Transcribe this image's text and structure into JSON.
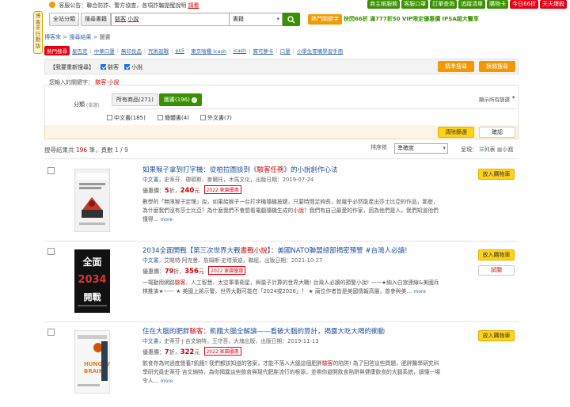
{
  "sidetab": "博客來\n行動版\n\n電腦版\n全站分類",
  "notice": {
    "label": "客服公告：",
    "text": "聯合防詐、警方協查，各項詐騙提醒說明",
    "link": "請看"
  },
  "toplinks": [
    {
      "label": "商主帳服務",
      "color": "#3a9100"
    },
    {
      "label": "客服口罩",
      "color": "#3a9100"
    },
    {
      "label": "訂單查詢",
      "color": "#3a9100"
    },
    {
      "label": "追蹤清單",
      "color": "#3a9100"
    },
    {
      "label": "購物卡",
      "color": "#3a9100"
    },
    {
      "label": "今日66折",
      "color": "#e60012"
    },
    {
      "label": "天天爆殺",
      "color": "#e60012"
    }
  ],
  "header": {
    "category_btn": "全站分類",
    "search_btn": "搜尋書籍",
    "search_keyword1": "駭客",
    "search_keyword2": "小說",
    "scope": "書籍",
    "hot_keywords_btn": "熱門關鍵字",
    "promo": "快閃66折 滿777折50 VIP限定優惠價 IPSA超大醫享"
  },
  "breadcrumb": {
    "home": "博客來",
    "sep1": ">",
    "search": "搜尋結果",
    "sep2": ">",
    "current": "圖書"
  },
  "hot_tag": "熱門搜尋",
  "hot_keywords": [
    "星巴克",
    "中華口罩",
    "無印良品",
    "咒術迴戰",
    "ps5",
    "東京喰種 icash",
    "icash",
    "寶可夢卡",
    "口罩",
    "小學生零嘴學習手冊"
  ],
  "refine": {
    "label": "【我要重新搜尋】",
    "opt1": "駭客",
    "opt2": "小說",
    "btn_precise": "精準搜尋",
    "btn_search": "換關搜尋"
  },
  "searched": {
    "label": "您輸入的關鍵字：",
    "kw1": "駭客",
    "kw2": "小說"
  },
  "filter": {
    "category_label": "分類",
    "category_hint": "(單選)",
    "chip_all": "所有商品(271)",
    "chip_books": "圖書(196)",
    "show_all": "顯示所有篩選",
    "sub_chinese": "中文書(185)",
    "sub_simplified": "簡體書(4)",
    "sub_foreign": "外文書(7)"
  },
  "apply": {
    "clear": "清除篩選",
    "ok": "確認"
  },
  "results_summary": {
    "prefix": "搜尋結果共",
    "count": "196",
    "suffix": "筆，頁數",
    "page": "1 / 9"
  },
  "sort": {
    "label": "排序依",
    "value": "準確度"
  },
  "view": {
    "label": "呈現：",
    "list": "列表",
    "grid": "小窩"
  },
  "items": [
    {
      "title_pre": "如果猴子拿到打字機：從柏拉圖談到《",
      "title_kw": "駭客任務",
      "title_post": "》的小說創作心法",
      "lang": "中文書",
      "authors": "史蒂芬．瓊碩斯．麥爾托",
      "publisher": "木馬文化",
      "date_label": "出版日期：",
      "date": "2019-07-24",
      "price_label": "優惠價：",
      "discount": "5",
      "discount_suffix": "折",
      "price": "240",
      "price_suffix": "元",
      "badge": "2022 家園優惠",
      "desc_pre": "數學的「無限猴子定理」說，如果給猴子一台打字機隨機按鍵，只要時間足夠長，就幾乎必然能產出莎士比亞的作品，那麼，為什麼我們沒有莎士比亞？為什麼我們不會想看電腦隨機生成的",
      "desc_kw": "小說",
      "desc_post": "？我們有自己最愛的作家，因為他們是人，我們知道他們懂得…",
      "more": "more",
      "cart": "放入購物車",
      "try": ""
    },
    {
      "title_pre": "2034全面開戰【第三次世界大戰",
      "title_kw": "書戰小說",
      "title_post": "】：美國NATO聯盟總部揭密預警 #台灣人必讀!",
      "lang": "中文書",
      "authors": "艾略特·阿克曼、詹姆斯·史塔萊迪",
      "publisher": "聯經",
      "date_label": "出版日期：",
      "date": "2021-10-27",
      "price_label": "優惠價：",
      "discount": "79",
      "discount_suffix": "折",
      "price": "356",
      "price_suffix": "元",
      "badge": "2022 家園優惠",
      "desc_pre": "一場動用網路",
      "desc_kw": "駭客",
      "desc_post": "、人工智慧、太空軍事衛星，與量子計算的世界大戰! 台灣人必讀的預警小說! ——★納入白宮連線&美國兵棋推演★—— ★ 美國上將示警，世界大戰可能在「2024或2026」！ ★ 兩位作者皆是美國情報高層，曾參與美…",
      "more": "more",
      "cart": "放入購物車",
      "try": "試閱"
    },
    {
      "title_pre": "住在大腦的肥胖",
      "title_kw": "駭客",
      "title_post": "：飢餓大腦全解讀——看破大腦的算計，揭露大吃大喝的衝動",
      "lang": "中文書",
      "authors": "史蒂芬·J·吉文納特",
      "publisher": "王守吾，大塊出版",
      "date_label": "出版日期：",
      "date": "2019-11-13",
      "price_label": "優惠價：",
      "discount": "7",
      "discount_suffix": "折",
      "price": "322",
      "price_suffix": "元",
      "badge": "2022 家園優惠",
      "desc_pre": "飲食存為何過度營養?飢餓? 我們都該知道的答案，才能不落入大腦這個肥胖",
      "desc_kw": "駭客",
      "desc_post": "的陷阱! 為了回答這些問題，肥胖醫學研究科學研究員史蒂芬·吉文納特，為你揭露這些飲食與現代肥胖流行的根源，並帶你避開飲食陷阱與健康飲食的大腦系統，讀懂一場令人…",
      "more": "more",
      "cart": "放入購物車",
      "try": ""
    }
  ]
}
